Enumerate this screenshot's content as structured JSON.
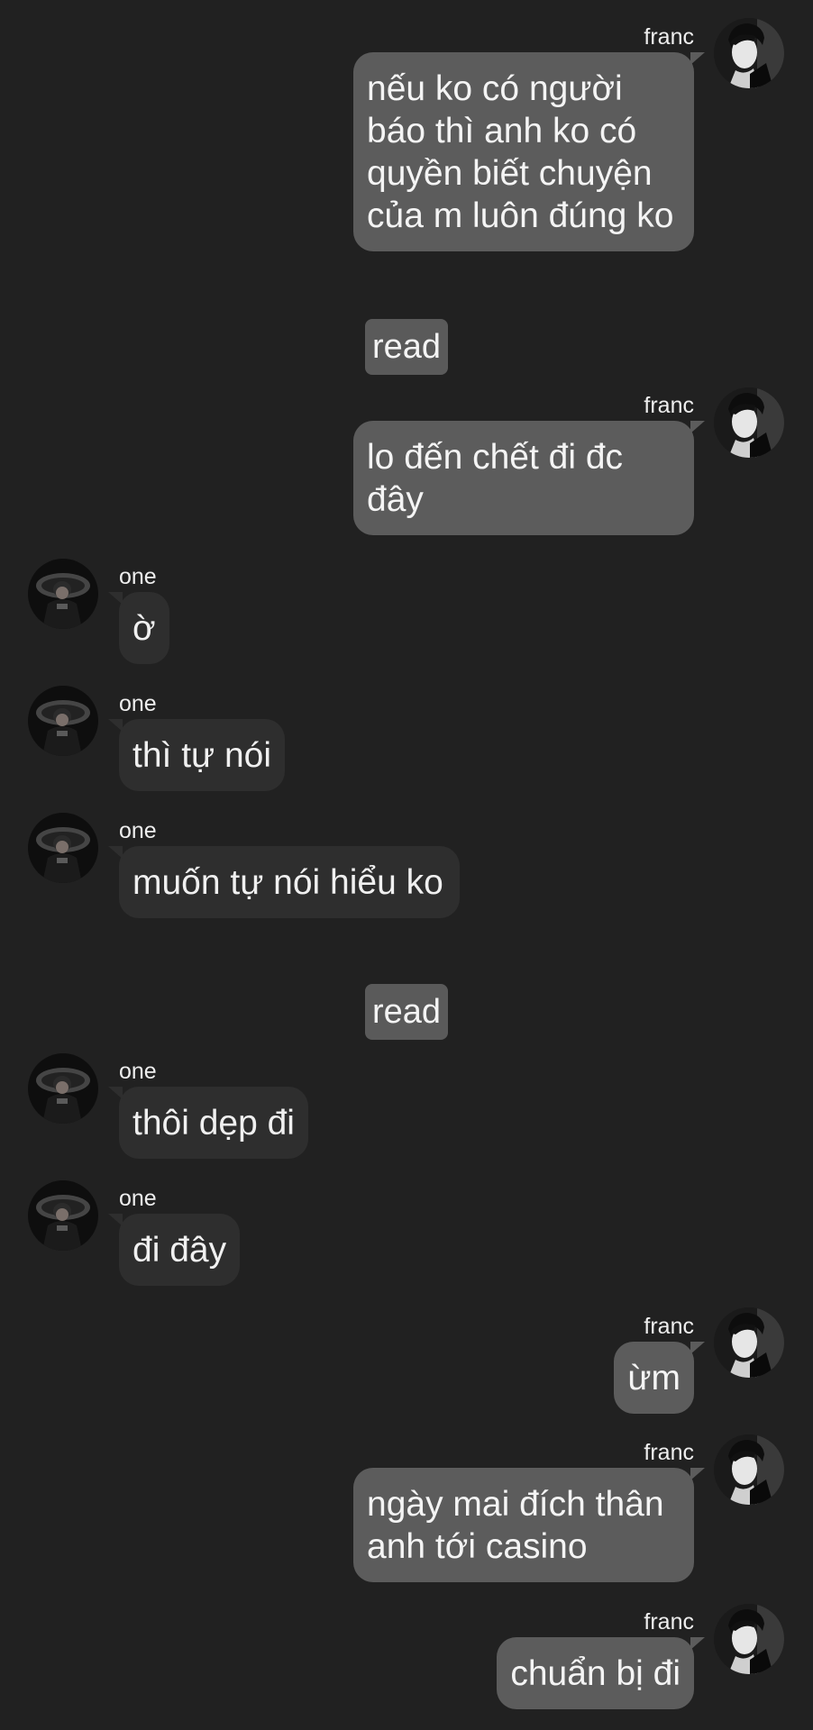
{
  "participants": {
    "me": {
      "name": "franc",
      "avatar_icon": "profile-photo-franc"
    },
    "other": {
      "name": "one",
      "avatar_icon": "profile-photo-one"
    }
  },
  "colors": {
    "background": "#212121",
    "my_bubble": "#5c5c5c",
    "other_bubble": "#2e2e2e",
    "read_badge": "#5a5a5a"
  },
  "messages": [
    {
      "sender": "franc",
      "text": "nếu ko có người báo thì anh ko có quyền biết chuyện của m luôn đúng ko"
    },
    {
      "read_label": "read"
    },
    {
      "sender": "franc",
      "text": "lo đến chết đi đc đây"
    },
    {
      "sender": "one",
      "text": "ờ"
    },
    {
      "sender": "one",
      "text": "thì tự nói"
    },
    {
      "sender": "one",
      "text": "muốn tự nói hiểu ko"
    },
    {
      "read_label": "read"
    },
    {
      "sender": "one",
      "text": "thôi dẹp đi"
    },
    {
      "sender": "one",
      "text": "đi đây"
    },
    {
      "sender": "franc",
      "text": "ừm"
    },
    {
      "sender": "franc",
      "text": "ngày mai đích thân anh tới casino"
    },
    {
      "sender": "franc",
      "text": "chuẩn bị đi"
    }
  ]
}
